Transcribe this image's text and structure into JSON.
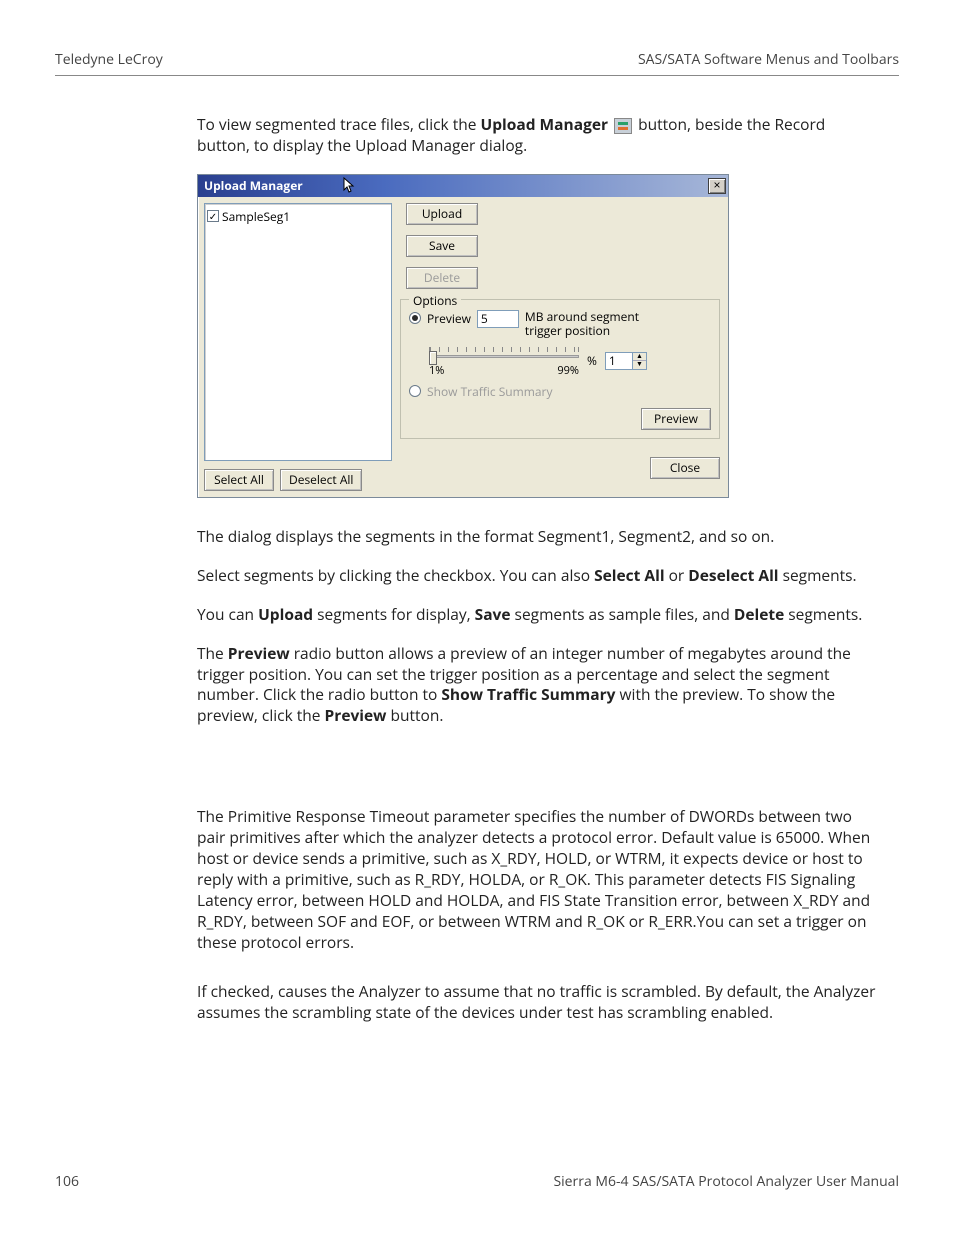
{
  "header": {
    "left": "Teledyne LeCroy",
    "right": "SAS/SATA Software Menus and Toolbars"
  },
  "intro": {
    "before_bold": "To view segmented trace files, click the ",
    "bold": "Upload Manager",
    "after_icon": " button, beside the Record button, to display the Upload Manager dialog."
  },
  "dialog": {
    "title": "Upload Manager",
    "close_x": "×",
    "segment_item": "SampleSeg1",
    "select_all": "Select All",
    "deselect_all": "Deselect All",
    "upload": "Upload",
    "save": "Save",
    "delete": "Delete",
    "options_label": "Options",
    "preview_radio": "Preview",
    "preview_value": "5",
    "preview_desc_l1": "MB around segment",
    "preview_desc_l2": "trigger position",
    "slider_min": "1%",
    "slider_max": "99%",
    "percent_sign": "%",
    "spin_value": "1",
    "show_traffic": "Show Traffic Summary",
    "preview_btn": "Preview",
    "close_btn": "Close"
  },
  "para1": "The dialog displays the segments in the format Segment1, Segment2, and so on.",
  "para2": {
    "t1": "Select segments by clicking the checkbox. You can also ",
    "b1": "Select All",
    "t2": " or ",
    "b2": "Deselect All",
    "t3": " segments."
  },
  "para3": {
    "t1": "You can ",
    "b1": "Upload",
    "t2": " segments for display, ",
    "b2": "Save",
    "t3": " segments as sample files, and ",
    "b3": "Delete",
    "t4": " segments."
  },
  "para4": {
    "t1": "The ",
    "b1": "Preview",
    "t2": " radio button allows a preview of an integer number of megabytes around the trigger position. You can set the trigger position as a percentage and select the segment number. Click the radio button to ",
    "b2": "Show Traffic Summary",
    "t3": " with the preview. To show the preview, click the ",
    "b3": "Preview",
    "t4": " button."
  },
  "para5": "The Primitive Response Timeout parameter specifies the number of DWORDs between two pair primitives after which the analyzer detects a protocol error. Default value is 65000. When host or device sends a primitive, such as X_RDY, HOLD, or WTRM, it expects device or host to reply with a primitive, such as R_RDY, HOLDA, or R_OK. This parameter detects FIS Signaling Latency error, between HOLD and HOLDA, and FIS State Transition error, between X_RDY and R_RDY, between SOF and EOF, or between WTRM and R_OK or R_ERR.You can set a trigger on these protocol errors.",
  "para6": "If checked, causes the Analyzer to assume that no traffic is scrambled. By default, the Analyzer assumes the scrambling state of the devices under test has scrambling enabled.",
  "footer": {
    "page": "106",
    "doc": "Sierra M6-4 SAS/SATA Protocol Analyzer User Manual"
  }
}
